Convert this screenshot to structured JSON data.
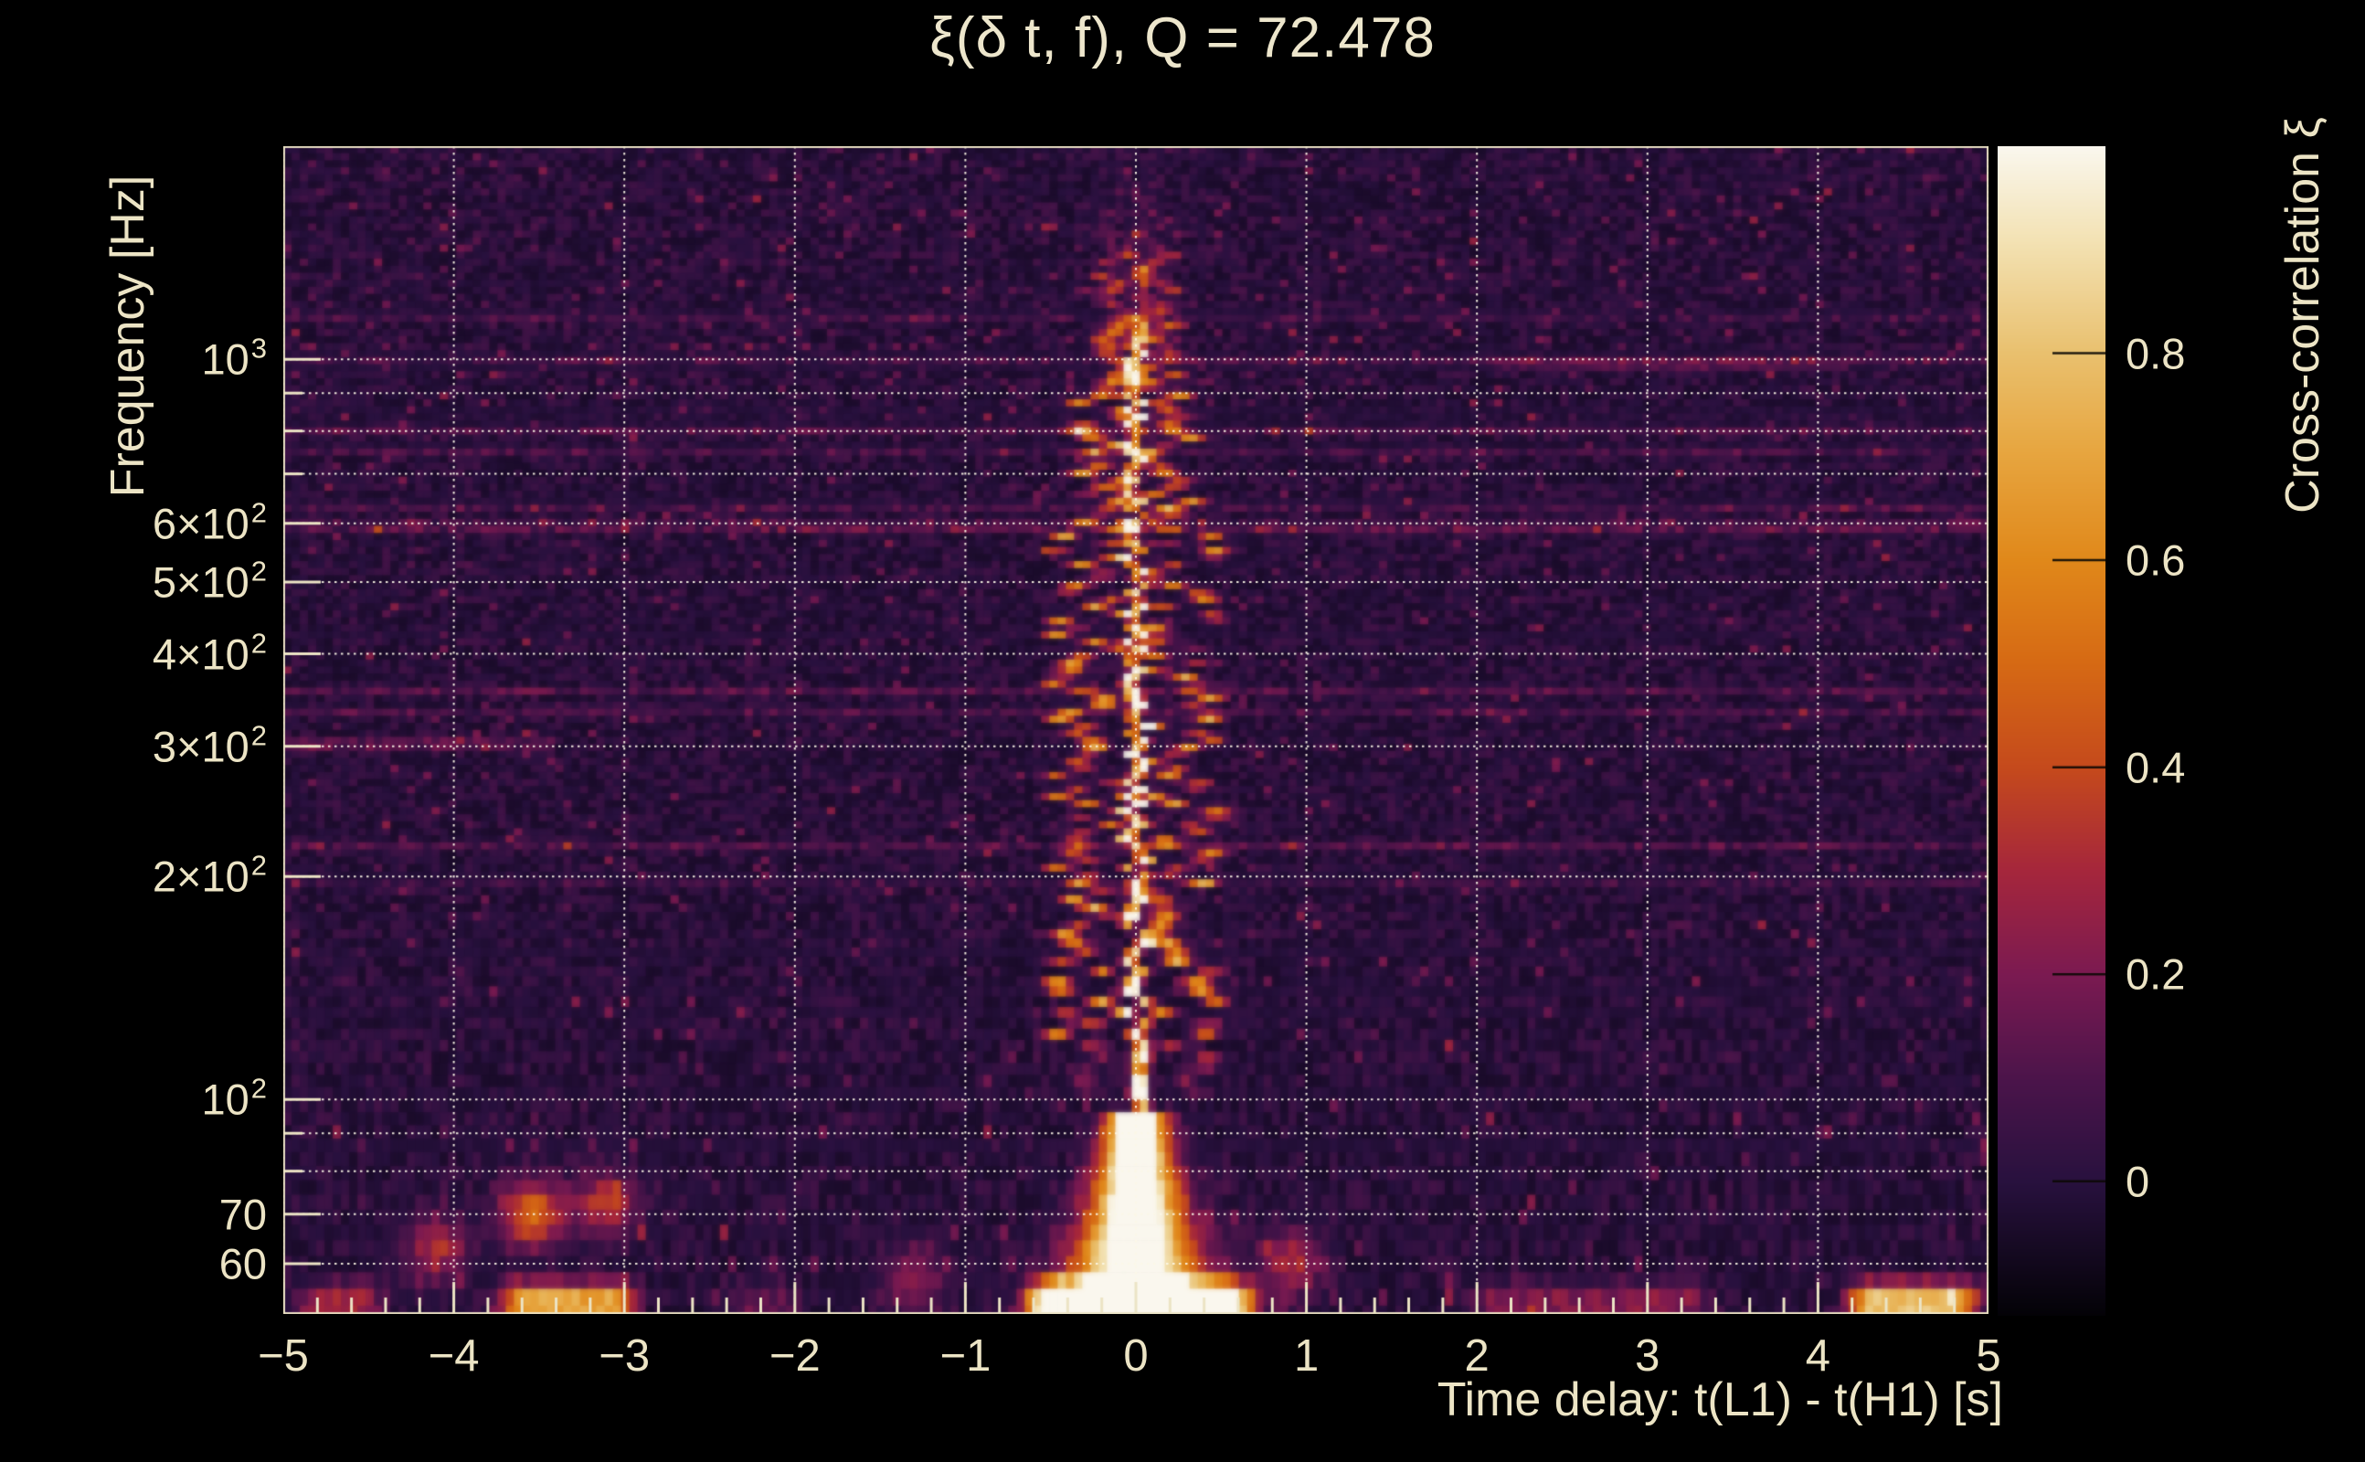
{
  "colors": {
    "page_bg": "#000000",
    "text": "#ece4c5",
    "grid": "rgba(252,247,231,0.92)",
    "axis": "#ece4c5",
    "cbar_tick": "rgba(12,9,4,0.9)"
  },
  "x_axis": {
    "title": "Time delay: t(L1) - t(H1) [s]",
    "range": [
      -5,
      5
    ],
    "tick_values": [
      -5,
      -4,
      -3,
      -2,
      -1,
      0,
      1,
      2,
      3,
      4,
      5
    ],
    "tick_labels": [
      "−5",
      "−4",
      "−3",
      "−2",
      "−1",
      "0",
      "1",
      "2",
      "3",
      "4",
      "5"
    ],
    "minor_step": 0.2
  },
  "y_axis": {
    "title": "Frequency [Hz]",
    "scale": "log",
    "range_hz": [
      51.3,
      1940
    ],
    "labeled_ticks": [
      {
        "f": 1000,
        "m": "10",
        "e": "3"
      },
      {
        "f": 600,
        "m": "6×10",
        "e": "2"
      },
      {
        "f": 500,
        "m": "5×10",
        "e": "2"
      },
      {
        "f": 400,
        "m": "4×10",
        "e": "2"
      },
      {
        "f": 300,
        "m": "3×10",
        "e": "2"
      },
      {
        "f": 200,
        "m": "2×10",
        "e": "2"
      },
      {
        "f": 100,
        "m": "10",
        "e": "2"
      },
      {
        "f": 70,
        "m": "70",
        "e": ""
      },
      {
        "f": 60,
        "m": "60",
        "e": ""
      }
    ],
    "grid_hz": [
      60,
      70,
      80,
      90,
      100,
      200,
      300,
      400,
      500,
      600,
      700,
      800,
      900,
      1000
    ]
  },
  "colorbar": {
    "title": "Cross-correlation ξ",
    "min": -0.13,
    "max": 1.0,
    "tick_values": [
      0.8,
      0.6,
      0.4,
      0.2,
      0
    ],
    "tick_labels": [
      "0.8",
      "0.6",
      "0.4",
      "0.2",
      "0"
    ]
  },
  "chart_data": {
    "type": "heatmap",
    "title": "ξ(δ t, f), Q = 72.478",
    "q_value": 72.478,
    "xlabel": "Time delay: t(L1) - t(H1) [s]",
    "ylabel": "Frequency [Hz]",
    "zlabel": "Cross-correlation ξ",
    "x_range_s": [
      -5,
      5
    ],
    "y_range_hz": [
      51.3,
      1940
    ],
    "z_range": [
      -0.13,
      1.0
    ],
    "grid": "dotted major/minor, log-y",
    "colormap_stops": [
      [
        0.0,
        3,
        2,
        6
      ],
      [
        0.115,
        40,
        17,
        62
      ],
      [
        0.2,
        74,
        20,
        74
      ],
      [
        0.292,
        123,
        26,
        81
      ],
      [
        0.38,
        165,
        38,
        60
      ],
      [
        0.469,
        197,
        74,
        28
      ],
      [
        0.56,
        214,
        106,
        20
      ],
      [
        0.646,
        224,
        136,
        26
      ],
      [
        0.74,
        231,
        166,
        64
      ],
      [
        0.823,
        233,
        192,
        110
      ],
      [
        0.92,
        243,
        226,
        180
      ],
      [
        1.0,
        250,
        247,
        238
      ]
    ],
    "features": {
      "noise_seed": 1337,
      "central_peak": {
        "t0_s": 0.0,
        "core_sigma_s": 0.045,
        "scatter_halfwidth_s": 0.42,
        "core_top_hz": 1000,
        "dots_top_hz": 1700,
        "low_f_blob_max_hz": 95,
        "peak_value": 1.0
      },
      "bottom_streaks": [
        {
          "t1": -5.0,
          "t2": -4.35,
          "amp": 0.25
        },
        {
          "t1": -3.8,
          "t2": -2.85,
          "amp": 0.62
        },
        {
          "t1": -2.5,
          "t2": -1.9,
          "amp": 0.12
        },
        {
          "t1": -0.7,
          "t2": 0.75,
          "amp": 0.95
        },
        {
          "t1": 1.9,
          "t2": 3.45,
          "amp": 0.18
        },
        {
          "t1": 4.1,
          "t2": 5.0,
          "amp": 0.72
        }
      ],
      "low_f_blobs": [
        {
          "t": -3.55,
          "f": 70,
          "amp": 0.5
        },
        {
          "t": -4.1,
          "f": 63,
          "amp": 0.3
        },
        {
          "t": -3.1,
          "f": 72,
          "amp": 0.35
        },
        {
          "t": 0.9,
          "f": 60,
          "amp": 0.3
        },
        {
          "t": -1.3,
          "f": 57,
          "amp": 0.25
        }
      ],
      "h_segments": [
        {
          "f": 300,
          "t1": -5.0,
          "t2": -3.4,
          "amp": 0.12
        },
        {
          "f": 990,
          "t1": 2.1,
          "t2": 4.2,
          "amp": 0.1
        }
      ]
    }
  }
}
